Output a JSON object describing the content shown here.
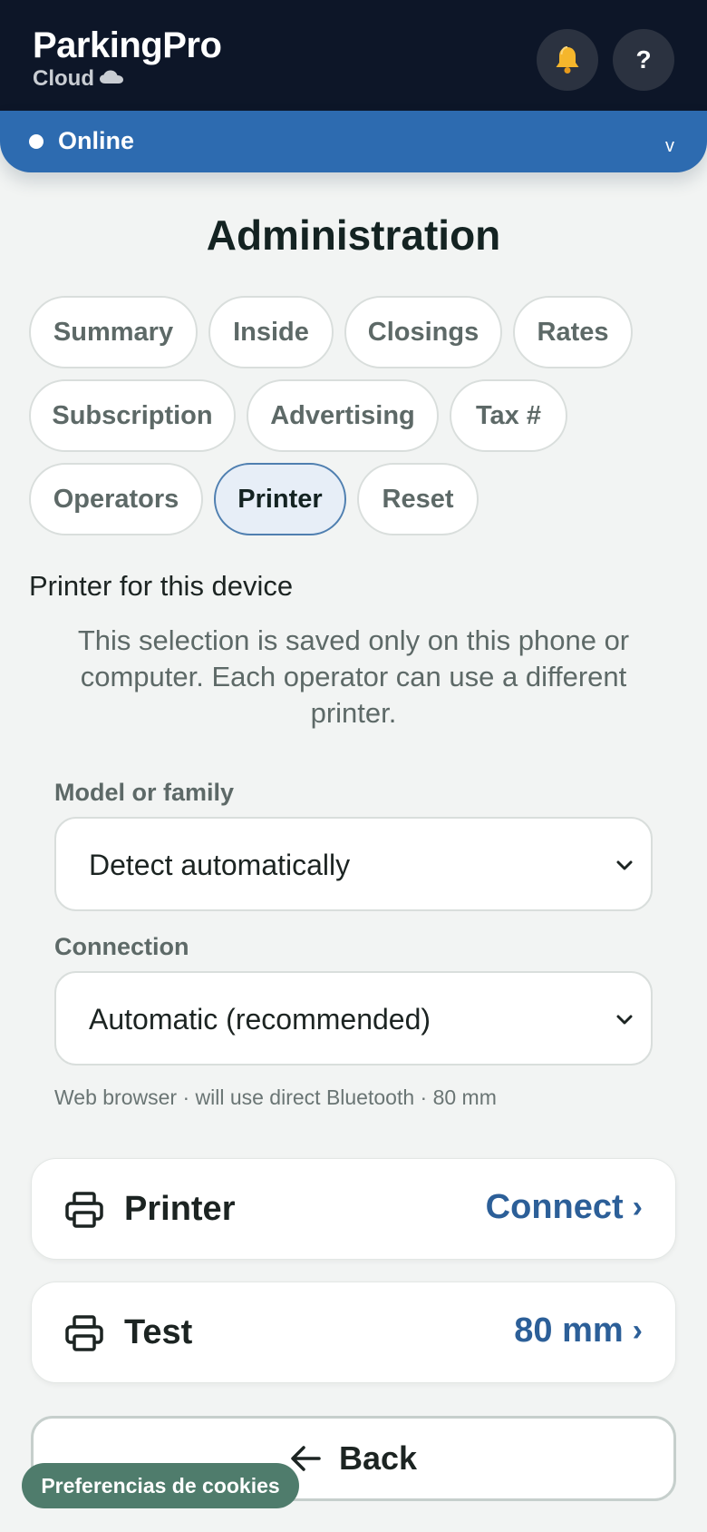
{
  "app": {
    "name": "ParkingPro",
    "subtitle": "Cloud"
  },
  "header": {
    "notifications_icon": "bell-icon",
    "help_label": "?"
  },
  "status": {
    "label": "Online",
    "chevron": "v",
    "dot_color": "#ffffff",
    "bar_color": "#2d6bb0"
  },
  "page": {
    "title": "Administration"
  },
  "tabs": [
    {
      "label": "Summary",
      "active": false
    },
    {
      "label": "Inside",
      "active": false
    },
    {
      "label": "Closings",
      "active": false
    },
    {
      "label": "Rates",
      "active": false
    },
    {
      "label": "Subscription",
      "active": false
    },
    {
      "label": "Advertising",
      "active": false
    },
    {
      "label": "Tax #",
      "active": false
    },
    {
      "label": "Operators",
      "active": false
    },
    {
      "label": "Printer",
      "active": true
    },
    {
      "label": "Reset",
      "active": false
    }
  ],
  "printer_section": {
    "title": "Printer for this device",
    "description": "This selection is saved only on this phone or computer. Each operator can use a different printer.",
    "model": {
      "label": "Model or family",
      "selected": "Detect automatically"
    },
    "connection": {
      "label": "Connection",
      "selected": "Automatic (recommended)"
    },
    "hint": "Web browser · will use direct Bluetooth · 80 mm"
  },
  "cards": {
    "printer": {
      "icon": "printer-icon",
      "label": "Printer",
      "action": "Connect",
      "arrow": "›"
    },
    "test": {
      "icon": "printer-icon",
      "label": "Test",
      "action": "80 mm",
      "arrow": "›"
    }
  },
  "back": {
    "label": "Back",
    "icon": "arrow-left-icon"
  },
  "cookies": {
    "label": "Preferencias de cookies"
  },
  "colors": {
    "accent": "#2c5f98",
    "header_bg": "#0d1628",
    "cookie_bg": "#4f7c6c"
  }
}
